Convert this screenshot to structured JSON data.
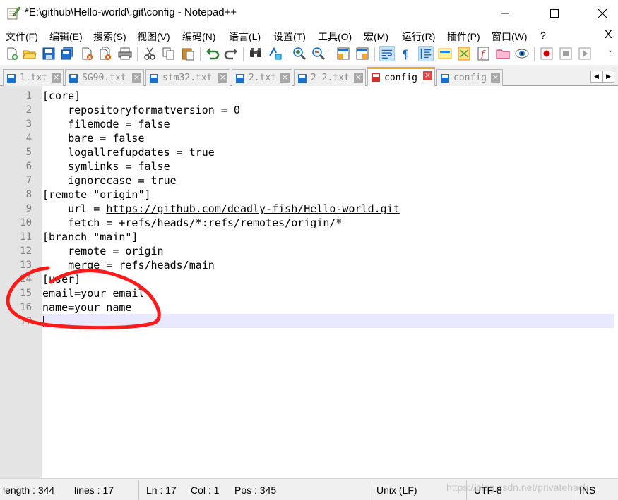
{
  "window": {
    "title": "*E:\\github\\Hello-world\\.git\\config - Notepad++",
    "controls": {
      "minimize": "minimize-icon",
      "maximize": "maximize-icon",
      "close": "close-icon"
    }
  },
  "menu": {
    "items": [
      "文件(F)",
      "编辑(E)",
      "搜索(S)",
      "视图(V)",
      "编码(N)",
      "语言(L)",
      "设置(T)",
      "工具(O)",
      "宏(M)",
      "运行(R)",
      "插件(P)",
      "窗口(W)",
      "?"
    ],
    "close_label": "X"
  },
  "tabs": [
    {
      "label": "1.txt",
      "active": false
    },
    {
      "label": "SG90.txt",
      "active": false
    },
    {
      "label": "stm32.txt",
      "active": false
    },
    {
      "label": "2.txt",
      "active": false
    },
    {
      "label": "2-2.txt",
      "active": false
    },
    {
      "label": "config",
      "active": true
    },
    {
      "label": "config",
      "active": false
    }
  ],
  "editor": {
    "lines": [
      "[core]",
      "    repositoryformatversion = 0",
      "    filemode = false",
      "    bare = false",
      "    logallrefupdates = true",
      "    symlinks = false",
      "    ignorecase = true",
      "[remote \"origin\"]",
      "    url = https://github.com/deadly-fish/Hello-world.git",
      "    fetch = +refs/heads/*:refs/remotes/origin/*",
      "[branch \"main\"]",
      "    remote = origin",
      "    merge = refs/heads/main",
      "[user]",
      "email=your email",
      "name=your name",
      ""
    ],
    "url_text": "https://github.com/deadly-fish/Hello-world.git",
    "annotation_color": "#ff1a1a"
  },
  "status": {
    "length": "length : 344",
    "lines": "lines : 17",
    "ln": "Ln : 17",
    "col": "Col : 1",
    "pos": "Pos : 345",
    "eol": "Unix (LF)",
    "encoding": "UTF-8",
    "mode": "INS",
    "watermark": "https://blog.csdn.net/privatehack"
  }
}
